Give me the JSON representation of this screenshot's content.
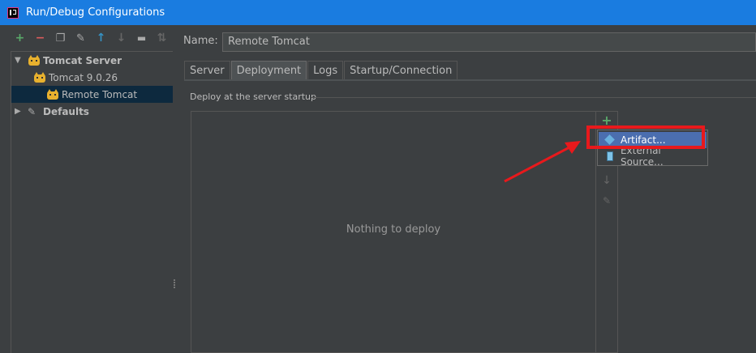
{
  "window": {
    "title": "Run/Debug Configurations"
  },
  "toolbar": {
    "items": [
      {
        "icon": "plus-icon",
        "glyph": "+",
        "color": "#59a869"
      },
      {
        "icon": "minus-icon",
        "glyph": "−",
        "color": "#db5c5c"
      },
      {
        "icon": "copy-icon",
        "glyph": "❐",
        "color": "#aaaaaa"
      },
      {
        "icon": "wrench-icon",
        "glyph": "✎",
        "color": "#aaaaaa"
      },
      {
        "icon": "arrow-up-icon",
        "glyph": "↑",
        "color": "#3592c4"
      },
      {
        "icon": "arrow-down-icon",
        "glyph": "↓",
        "color": "#666666"
      },
      {
        "icon": "folder-icon",
        "glyph": "▬",
        "color": "#aaaaaa"
      },
      {
        "icon": "sort-icon",
        "glyph": "⇅",
        "color": "#666666"
      }
    ]
  },
  "tree": {
    "items": [
      {
        "label": "Tomcat Server",
        "expanded": true
      },
      {
        "label": "Tomcat 9.0.26"
      },
      {
        "label": "Remote Tomcat",
        "selected": true
      },
      {
        "label": "Defaults",
        "expanded": false
      }
    ]
  },
  "form": {
    "name_label": "Name:",
    "name_value": "Remote Tomcat"
  },
  "tabs": [
    {
      "label": "Server"
    },
    {
      "label": "Deployment",
      "active": true
    },
    {
      "label": "Logs"
    },
    {
      "label": "Startup/Connection"
    }
  ],
  "deployment": {
    "group_title": "Deploy at the server startup",
    "empty_text": "Nothing to deploy"
  },
  "popup": {
    "items": [
      {
        "label": "Artifact...",
        "icon": "artifact-icon",
        "selected": true
      },
      {
        "label": "External Source...",
        "icon": "archive-icon"
      }
    ]
  },
  "colors": {
    "titlebar": "#1a7ce0",
    "background": "#3c3f41",
    "selection": "#4b6eaf",
    "highlight": "#e8191c"
  }
}
